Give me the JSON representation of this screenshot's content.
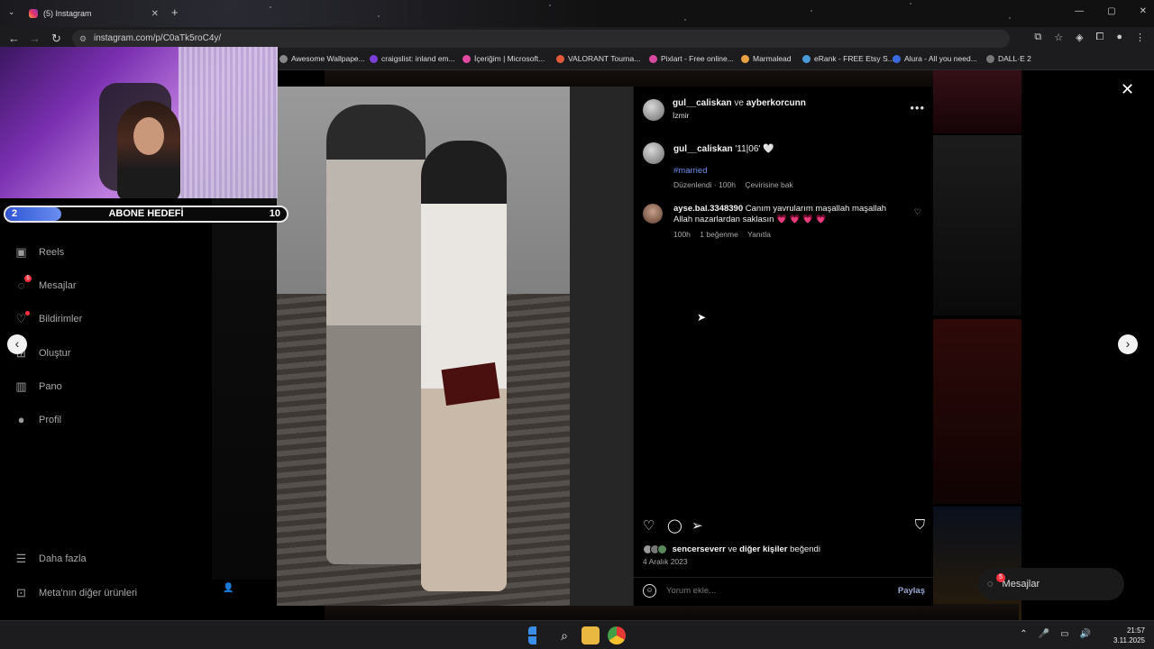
{
  "browser": {
    "tab_title": "(5) Instagram",
    "url": "instagram.com/p/C0aTk5roC4y/",
    "bookmarks": [
      {
        "label": "Awesome Wallpape...",
        "color": "#888"
      },
      {
        "label": "craigslist: inland em...",
        "color": "#7b3fd8"
      },
      {
        "label": "İçeriğim | Microsoft...",
        "color": "#e04aa0"
      },
      {
        "label": "VALORANT Tourna...",
        "color": "#e05a3a"
      },
      {
        "label": "Pixlart - Free online...",
        "color": "#d84aa0"
      },
      {
        "label": "Marmalead",
        "color": "#e8a040"
      },
      {
        "label": "eRank - FREE Etsy S...",
        "color": "#4a9ad8"
      },
      {
        "label": "Alura - All you need...",
        "color": "#3a6ae0"
      },
      {
        "label": "DALL·E 2",
        "color": "#777"
      }
    ]
  },
  "stream": {
    "goal_label": "ABONE HEDEFİ",
    "goal_current": "2",
    "goal_target": "10",
    "goal_fraction": 0.2
  },
  "sidebar": {
    "items": [
      {
        "label": "Reels",
        "icon": "reels-icon",
        "glyph": "▣"
      },
      {
        "label": "Mesajlar",
        "icon": "messenger-icon",
        "glyph": "◌"
      },
      {
        "label": "Bildirimler",
        "icon": "heart-icon",
        "glyph": "♡"
      },
      {
        "label": "Oluştur",
        "icon": "create-icon",
        "glyph": "⊞"
      },
      {
        "label": "Pano",
        "icon": "dashboard-icon",
        "glyph": "▥"
      },
      {
        "label": "Profil",
        "icon": "profile-icon",
        "glyph": "●"
      }
    ],
    "more_label": "Daha fazla",
    "meta_label": "Meta'nın diğer ürünleri"
  },
  "post": {
    "user1": "gul__caliskan",
    "and_word": "ve",
    "user2": "ayberkorcunn",
    "location": "İzmir",
    "caption_user": "gul__caliskan",
    "caption_text": "'11|06' 🤍",
    "hashtag": "#married",
    "edited": "Düzenlendi · 100h",
    "translate": "Çevirisine bak",
    "comment": {
      "user": "ayse.bal.3348390",
      "text": "Canım yavrularım maşallah maşallah Allah nazarlardan saklasın",
      "hearts": "💗 💗 💗 💗",
      "time": "100h",
      "likes": "1 beğenme",
      "reply": "Yanıtla"
    },
    "liked_by_user": "sencerseverr",
    "liked_by_and": "ve",
    "liked_by_others": "diğer kişiler",
    "liked_by_suffix": "beğendi",
    "date": "4 Aralık 2023",
    "add_comment_placeholder": "Yorum ekle...",
    "share_label": "Paylaş"
  },
  "messages_bar": {
    "label": "Mesajlar",
    "badge": "5"
  },
  "taskbar": {
    "time": "21:57",
    "date": "3.11.2025"
  }
}
